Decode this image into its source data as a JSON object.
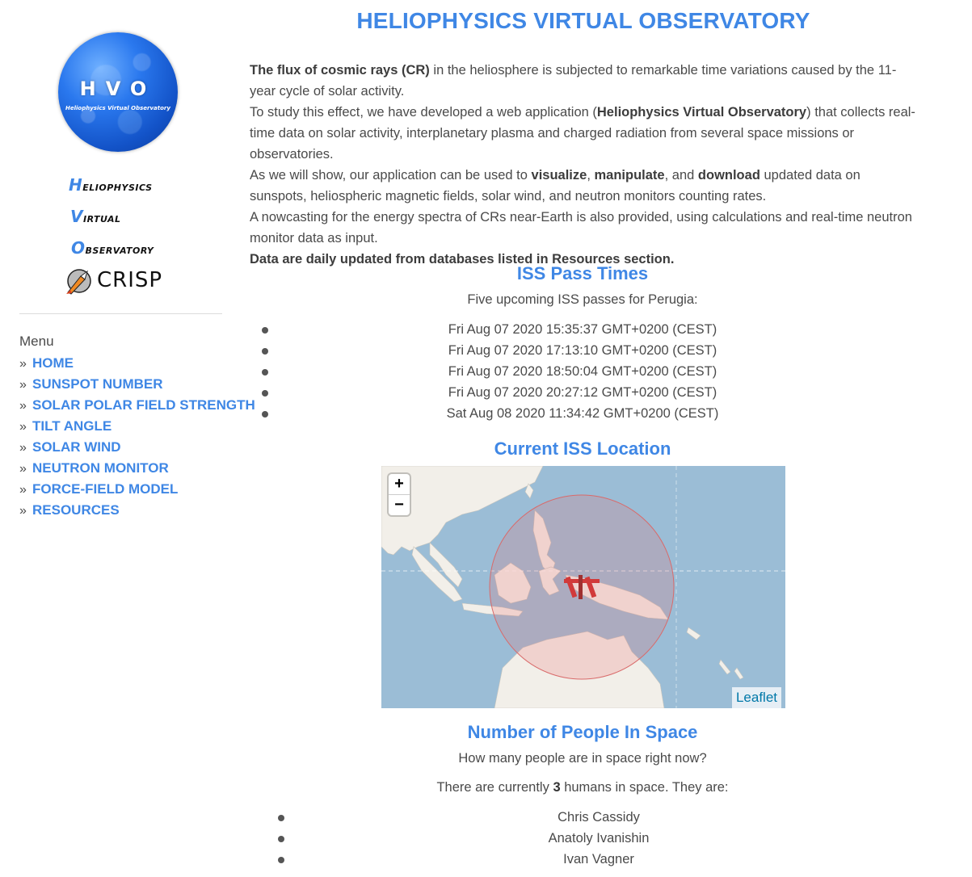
{
  "sidebar": {
    "logo": {
      "main": "HVO",
      "sub": "Heliophysics Virtual Observatory"
    },
    "wordmarks": [
      {
        "cap": "H",
        "rest": "eliophysics"
      },
      {
        "cap": "V",
        "rest": "irtual"
      },
      {
        "cap": "O",
        "rest": "bservatory"
      }
    ],
    "crisp": "CRISP",
    "menu_title": "Menu",
    "menu_items": [
      {
        "label": "HOME"
      },
      {
        "label": "SUNSPOT NUMBER"
      },
      {
        "label": "SOLAR POLAR FIELD STRENGTH"
      },
      {
        "label": "TILT ANGLE"
      },
      {
        "label": "SOLAR WIND"
      },
      {
        "label": "NEUTRON MONITOR"
      },
      {
        "label": "FORCE-FIELD MODEL"
      },
      {
        "label": "RESOURCES"
      }
    ]
  },
  "header": {
    "title": "HELIOPHYSICS VIRTUAL OBSERVATORY"
  },
  "intro": {
    "p1_bold": "The flux of cosmic rays (CR)",
    "p1_rest": " in the heliosphere is subjected to remarkable time variations caused by the 11-year cycle of solar activity.",
    "p2_pre": "To study this effect, we have developed a web application (",
    "p2_bold": "Heliophysics Virtual Observatory",
    "p2_post": ") that collects real-time data on solar activity, interplanetary plasma and charged radiation from several space missions or observatories.",
    "p3_pre": "As we will show, our application can be used to ",
    "p3_b1": "visualize",
    "p3_sep1": ", ",
    "p3_b2": "manipulate",
    "p3_sep2": ", and ",
    "p3_b3": "download",
    "p3_post": " updated data on sunspots, heliospheric magnetic fields, solar wind, and neutron monitors counting rates.",
    "p4": "A nowcasting for the energy spectra of CRs near-Earth is also provided, using calculations and real-time neutron monitor data as input.",
    "p5_bold": "Data are daily updated from databases listed in Resources section."
  },
  "iss_pass": {
    "title": "ISS Pass Times",
    "subtitle": "Five upcoming ISS passes for Perugia:",
    "passes": [
      "Fri Aug 07 2020 15:35:37 GMT+0200 (CEST)",
      "Fri Aug 07 2020 17:13:10 GMT+0200 (CEST)",
      "Fri Aug 07 2020 18:50:04 GMT+0200 (CEST)",
      "Fri Aug 07 2020 20:27:12 GMT+0200 (CEST)",
      "Sat Aug 08 2020 11:34:42 GMT+0200 (CEST)"
    ]
  },
  "iss_location": {
    "title": "Current ISS Location",
    "zoom_in": "+",
    "zoom_out": "−",
    "attribution": "Leaflet",
    "colors": {
      "sea": "#9bbdd6",
      "land": "#f2efe9",
      "footprint": "#e06a6a"
    }
  },
  "people": {
    "title": "Number of People In Space",
    "question": "How many people are in space right now?",
    "count_pre": "There are currently ",
    "count": "3",
    "count_post": " humans in space. They are:",
    "names": [
      "Chris Cassidy",
      "Anatoly Ivanishin",
      "Ivan Vagner"
    ]
  },
  "colors": {
    "accent": "#3f87e5",
    "text": "#4a4a4a"
  }
}
